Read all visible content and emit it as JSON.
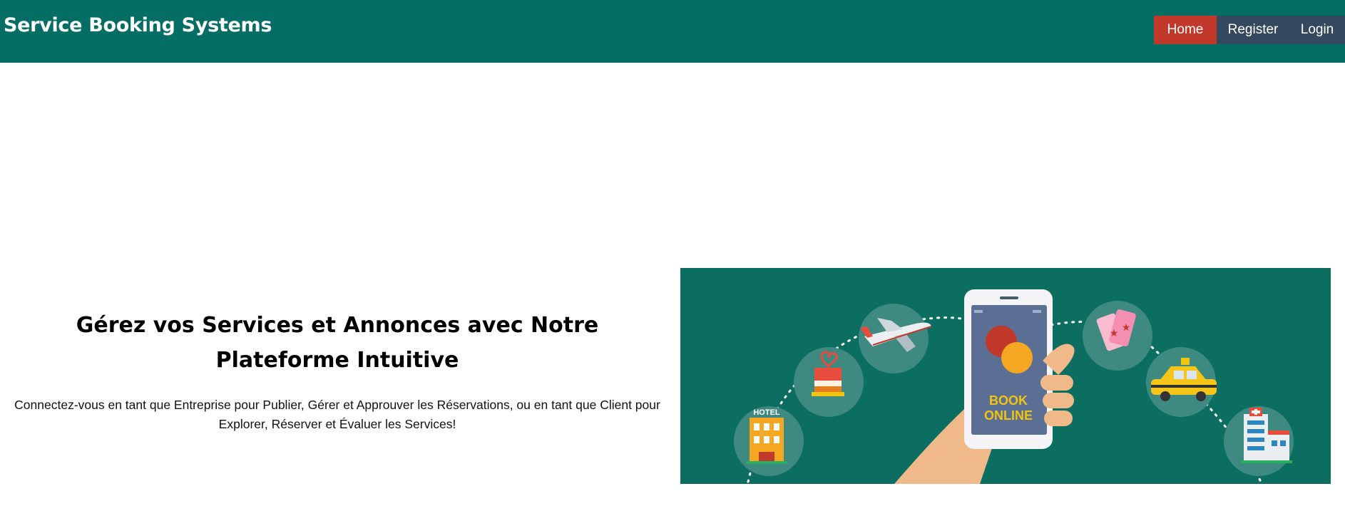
{
  "navbar": {
    "brand": "Service Booking Systems",
    "links": [
      {
        "label": "Home",
        "active": true
      },
      {
        "label": "Register",
        "active": false
      },
      {
        "label": "Login",
        "active": false
      }
    ]
  },
  "hero": {
    "title": "Gérez vos Services et Annonces avec Notre Plateforme Intuitive",
    "subtitle": "Connectez-vous en tant que Entreprise pour Publier, Gérer et Approuver les Réservations, ou en tant que Client pour Explorer, Réserver et Évaluer les Services!"
  },
  "illustration": {
    "phone_text_line1": "BOOK",
    "phone_text_line2": "ONLINE",
    "hotel_label": "HOTEL",
    "icons": [
      "hotel-icon",
      "cake-icon",
      "airplane-icon",
      "tickets-icon",
      "taxi-icon",
      "hospital-icon"
    ]
  },
  "colors": {
    "navbar": "#046e65",
    "home_active": "#c0392b",
    "nav_inactive": "#34495e",
    "illustration_bg": "#0b6e61"
  }
}
